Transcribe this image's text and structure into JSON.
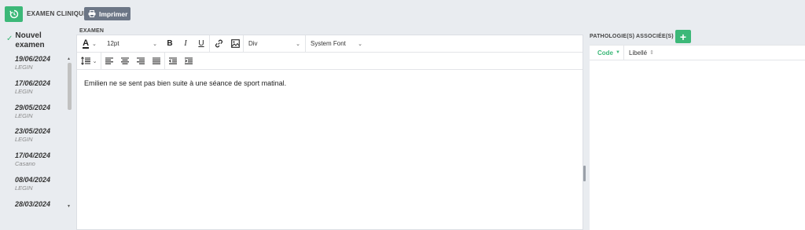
{
  "header": {
    "section_title": "EXAMEN CLINIQUE",
    "print_label": "Imprimer"
  },
  "sidebar": {
    "new_exam_line1": "Nouvel",
    "new_exam_line2": "examen",
    "items": [
      {
        "date": "19/06/2024",
        "who": "LEGIN"
      },
      {
        "date": "17/06/2024",
        "who": "LEGIN"
      },
      {
        "date": "29/05/2024",
        "who": "LEGIN"
      },
      {
        "date": "23/05/2024",
        "who": "LEGIN"
      },
      {
        "date": "17/04/2024",
        "who": "Casano"
      },
      {
        "date": "08/04/2024",
        "who": "LEGIN"
      },
      {
        "date": "28/03/2024",
        "who": ""
      }
    ]
  },
  "editor": {
    "label": "EXAMEN",
    "font_size": "12pt",
    "block_format": "Div",
    "font_family": "System Font",
    "body_text": "Emilien ne se sent pas bien suite à une séance de sport matinal."
  },
  "pathologies": {
    "title": "PATHOLOGIE(S) ASSOCIÉE(S)",
    "add_label": "+",
    "columns": {
      "code": "Code",
      "libelle": "Libellé"
    }
  },
  "colors": {
    "accent": "#3cb878",
    "print_button": "#6c7686",
    "background": "#e9ecf0"
  },
  "icons": [
    "history-icon",
    "printer-icon",
    "text-color-icon",
    "bold-icon",
    "italic-icon",
    "underline-icon",
    "link-icon",
    "image-icon",
    "line-height-icon",
    "align-left-icon",
    "align-center-icon",
    "align-right-icon",
    "justify-icon",
    "outdent-icon",
    "indent-icon",
    "check-icon",
    "sort-icon"
  ]
}
